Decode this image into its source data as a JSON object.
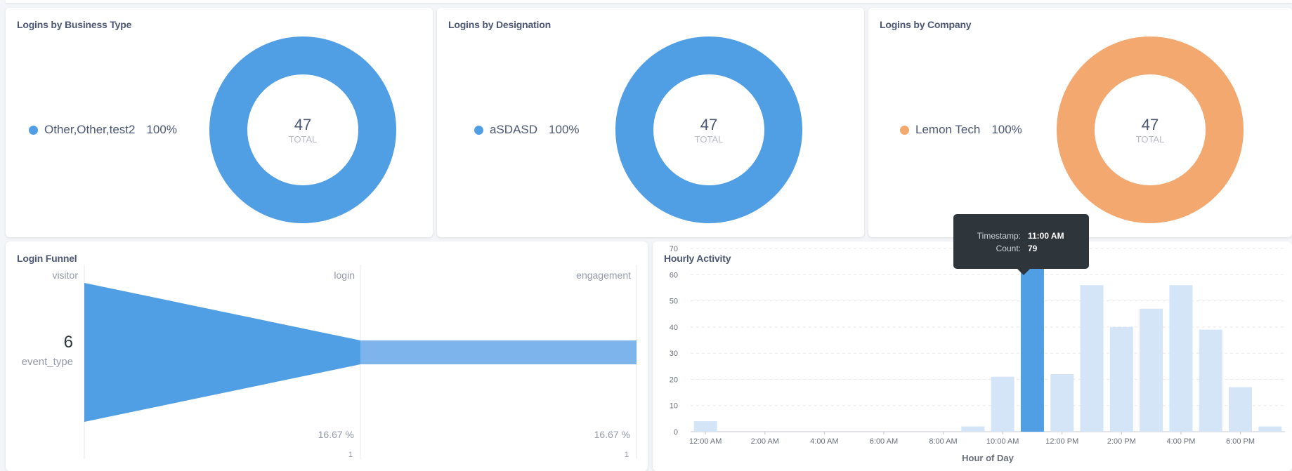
{
  "colors": {
    "blue": "#509ee3",
    "blue_light": "#7cb4eb",
    "blue_faded": "#d3e5f7",
    "orange": "#f2a86f"
  },
  "cards": {
    "business_type": {
      "title": "Logins by Business Type",
      "legend_label": "Other,Other,test2",
      "legend_pct": "100%",
      "total": "47",
      "total_label": "TOTAL"
    },
    "designation": {
      "title": "Logins by Designation",
      "legend_label": "aSDASD",
      "legend_pct": "100%",
      "total": "47",
      "total_label": "TOTAL"
    },
    "company": {
      "title": "Logins by Company",
      "legend_label": "Lemon Tech",
      "legend_pct": "100%",
      "total": "47",
      "total_label": "TOTAL"
    }
  },
  "funnel": {
    "title": "Login Funnel",
    "row_value": "6",
    "row_label": "event_type",
    "steps": [
      "visitor",
      "login",
      "engagement"
    ],
    "percents": [
      "16.67 %",
      "16.67 %"
    ],
    "counts": [
      "1",
      "1"
    ]
  },
  "hourly": {
    "title": "Hourly Activity",
    "tooltip": {
      "timestamp_key": "Timestamp:",
      "timestamp_val": "11:00 AM",
      "count_key": "Count:",
      "count_val": "79"
    }
  },
  "chart_data": [
    {
      "type": "pie",
      "title": "Logins by Business Type",
      "labels": [
        "Other,Other,test2"
      ],
      "values": [
        47
      ],
      "percents": [
        "100%"
      ],
      "total": 47
    },
    {
      "type": "pie",
      "title": "Logins by Designation",
      "labels": [
        "aSDASD"
      ],
      "values": [
        47
      ],
      "percents": [
        "100%"
      ],
      "total": 47
    },
    {
      "type": "pie",
      "title": "Logins by Company",
      "labels": [
        "Lemon Tech"
      ],
      "values": [
        47
      ],
      "percents": [
        "100%"
      ],
      "total": 47
    },
    {
      "type": "funnel",
      "title": "Login Funnel",
      "steps": [
        "visitor",
        "login",
        "engagement"
      ],
      "values": [
        6,
        1,
        1
      ],
      "percents": [
        "16.67 %",
        "16.67 %"
      ]
    },
    {
      "type": "bar",
      "title": "Hourly Activity",
      "xlabel": "Hour of Day",
      "ylabel": "",
      "ylim": [
        0,
        70
      ],
      "yticks": [
        0,
        10,
        20,
        30,
        40,
        50,
        60,
        70
      ],
      "xtick_labels": [
        "12:00 AM",
        "2:00 AM",
        "4:00 AM",
        "6:00 AM",
        "8:00 AM",
        "10:00 AM",
        "12:00 PM",
        "2:00 PM",
        "4:00 PM",
        "6:00 PM"
      ],
      "categories": [
        "12:00 AM",
        "1:00 AM",
        "2:00 AM",
        "3:00 AM",
        "4:00 AM",
        "5:00 AM",
        "6:00 AM",
        "7:00 AM",
        "8:00 AM",
        "9:00 AM",
        "10:00 AM",
        "11:00 AM",
        "12:00 PM",
        "1:00 PM",
        "2:00 PM",
        "3:00 PM",
        "4:00 PM",
        "5:00 PM",
        "6:00 PM",
        "7:00 PM"
      ],
      "values": [
        4,
        0,
        0,
        0,
        0,
        0,
        0,
        0,
        0,
        2,
        21,
        79,
        22,
        56,
        40,
        47,
        56,
        39,
        17,
        2
      ],
      "highlighted": "11:00 AM",
      "grid": true
    }
  ]
}
